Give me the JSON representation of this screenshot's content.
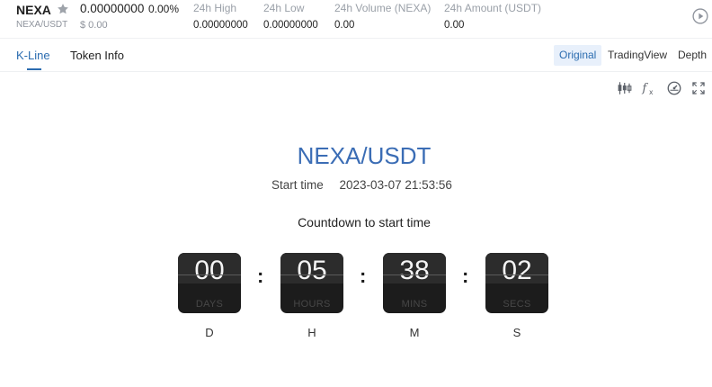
{
  "ticker": {
    "symbol": "NEXA",
    "pair": "NEXA/USDT",
    "last_price": "0.00000000",
    "change_pct": "0.00%",
    "usd_price": "$ 0.00",
    "stats": [
      {
        "label": "24h High",
        "value": "0.00000000"
      },
      {
        "label": "24h Low",
        "value": "0.00000000"
      },
      {
        "label": "24h Volume (NEXA)",
        "value": "0.00"
      },
      {
        "label": "24h Amount (USDT)",
        "value": "0.00"
      }
    ]
  },
  "tabs": {
    "items": [
      {
        "label": "K-Line",
        "active": true
      },
      {
        "label": "Token Info",
        "active": false
      }
    ]
  },
  "view_options": {
    "items": [
      {
        "label": "Original",
        "selected": true
      },
      {
        "label": "TradingView",
        "selected": false
      },
      {
        "label": "Depth",
        "selected": false
      }
    ]
  },
  "toolbar": {
    "icons": [
      "candlestick-settings-icon",
      "function-icon",
      "dashboard-icon",
      "fullscreen-icon"
    ]
  },
  "launch": {
    "title": "NEXA/USDT",
    "start_label": "Start time",
    "start_time": "2023-03-07 21:53:56",
    "countdown_title": "Countdown to start time",
    "units": [
      {
        "value": "00",
        "label": "DAYS",
        "letter": "D"
      },
      {
        "value": "05",
        "label": "HOURS",
        "letter": "H"
      },
      {
        "value": "38",
        "label": "MINS",
        "letter": "M"
      },
      {
        "value": "02",
        "label": "SECS",
        "letter": "S"
      }
    ]
  },
  "colors": {
    "accent": "#2b6cb0",
    "title_blue": "#3b6db5",
    "selected_bg": "#e8f0fb",
    "countdown_box": "#1c1c1c"
  }
}
